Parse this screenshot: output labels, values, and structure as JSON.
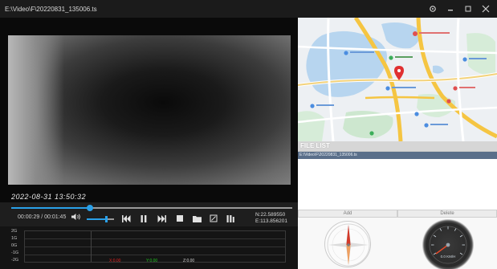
{
  "window": {
    "title": "E:\\Video\\F\\20220831_135006.ts",
    "controls": [
      "settings-icon",
      "minimize-icon",
      "maximize-icon",
      "close-icon"
    ]
  },
  "video": {
    "overlay_timestamp": "2022-08-31 13:50:32"
  },
  "playback": {
    "time": "00:00:29 / 00:01:45",
    "seek_progress": 0.28,
    "volume_level": 0.72,
    "buttons": [
      "volume-icon",
      "previous-icon",
      "pause-icon",
      "next-icon",
      "stop-icon",
      "folder-icon",
      "screenshot-icon",
      "playlist-icon"
    ]
  },
  "gps": {
    "lat": "N:22.589550",
    "lon": "E:113.856201"
  },
  "graph": {
    "y_labels": [
      "2G",
      "1G",
      "0G",
      "-1G",
      "-2G"
    ],
    "x_values": [
      "X:0.00",
      "Y:0.00",
      "Z:0.00"
    ],
    "colors": {
      "x": "#e02020",
      "y": "#20c020",
      "z": "#d0d0d0"
    }
  },
  "file_list": {
    "header": "FILE LIST",
    "items": [
      "E:\\Video\\F\\20220831_135006.ts"
    ]
  },
  "actions": {
    "add": "Add",
    "delete": "Delete"
  },
  "speedometer": {
    "readout": "0.0 KM/H"
  },
  "colors": {
    "accent": "#2aa0e8",
    "map_pin": "#e03030"
  }
}
